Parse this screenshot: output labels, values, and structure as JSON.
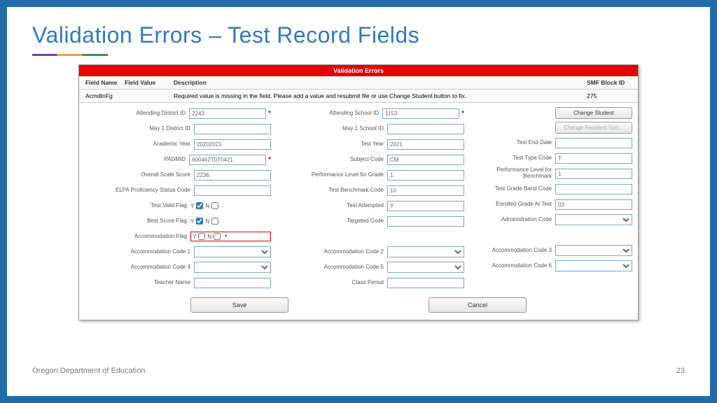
{
  "slide": {
    "title": "Validation Errors – Test Record Fields",
    "footer_org": "Oregon Department of Education",
    "page_number": "23"
  },
  "panel": {
    "title": "Validation Errors",
    "columns": {
      "field_name": "Field Name",
      "field_value": "Field Value",
      "description": "Description",
      "block_id": "SMF Block ID"
    },
    "error": {
      "field_name": "AcmdtnFg",
      "field_value": "",
      "description": "Required value is missing in the field. Please add a value and resubmit file or use Change Student button to fix.",
      "block_id": "275"
    },
    "buttons": {
      "change_student": "Change Student",
      "change_resident": "Change Resident Sch…",
      "save": "Save",
      "cancel": "Cancel"
    },
    "fields": {
      "attending_district_id": {
        "label": "Attending District ID",
        "value": "2243",
        "required": true
      },
      "may1_district_id": {
        "label": "May 1 District ID",
        "value": ""
      },
      "academic_year": {
        "label": "Academic Year",
        "value": "20202021"
      },
      "padmid": {
        "label": "PADMID",
        "value": "600462T0T0421",
        "required": true
      },
      "overall_scale_score": {
        "label": "Overall Scale Score",
        "value": "2236"
      },
      "elpa_status": {
        "label": "ELPA Proficiency Status Code",
        "value": ""
      },
      "test_valid_flag": {
        "label": "Test Valid Flag",
        "y": true,
        "n": false
      },
      "best_score_flag": {
        "label": "Best Score Flag",
        "y": true,
        "n": false
      },
      "accommodation_flag": {
        "label": "Accommodation Flag",
        "y": false,
        "n": false,
        "error": true
      },
      "accommodation_code_1": {
        "label": "Accommodation Code 1"
      },
      "accommodation_code_4": {
        "label": "Accommodation Code 4"
      },
      "teacher_name": {
        "label": "Teacher Name",
        "value": ""
      },
      "attending_school_id": {
        "label": "Attending School ID",
        "value": "1153",
        "required": true
      },
      "may1_school_id": {
        "label": "May 1 School ID",
        "value": ""
      },
      "test_year": {
        "label": "Test Year",
        "value": "2021"
      },
      "subject_code": {
        "label": "Subject Code",
        "value": "CM"
      },
      "perf_level_grade": {
        "label": "Performance Level for Grade",
        "value": "1"
      },
      "test_benchmark_code": {
        "label": "Test Benchmark Code",
        "value": "10"
      },
      "test_attempted": {
        "label": "Test Attempted",
        "value": "Y"
      },
      "targeted_code": {
        "label": "Targeted Code",
        "value": ""
      },
      "accommodation_code_2": {
        "label": "Accommodation Code 2"
      },
      "accommodation_code_5": {
        "label": "Accommodation Code 5"
      },
      "class_period": {
        "label": "Class Period",
        "value": ""
      },
      "test_end_date": {
        "label": "Test End Date",
        "value": ""
      },
      "test_type_code": {
        "label": "Test Type Code",
        "value": "T"
      },
      "perf_level_benchmark": {
        "label": "Performance Level for Benchmark",
        "value": "1"
      },
      "test_grade_band": {
        "label": "Test Grade Band Code",
        "value": ""
      },
      "enrolled_grade": {
        "label": "Enrolled Grade At Test",
        "value": "03"
      },
      "admin_code": {
        "label": "Administration Code"
      },
      "accommodation_code_3": {
        "label": "Accommodation Code 3"
      },
      "accommodation_code_6": {
        "label": "Accommodation Code 6"
      }
    }
  }
}
